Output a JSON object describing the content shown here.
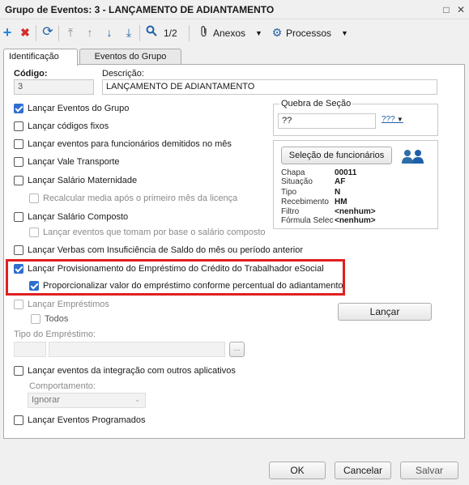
{
  "window": {
    "title": "Grupo de Eventos: 3 - LANÇAMENTO DE ADIANTAMENTO"
  },
  "toolbar": {
    "page_indicator": "1/2",
    "anexos_label": "Anexos",
    "processos_label": "Processos"
  },
  "tabs": [
    {
      "label": "Identificação",
      "active": true
    },
    {
      "label": "Eventos do Grupo",
      "active": false
    }
  ],
  "form": {
    "codigo_label": "Código:",
    "codigo_value": "3",
    "descricao_label": "Descrição:",
    "descricao_value": "LANÇAMENTO DE ADIANTAMENTO",
    "quebra_label": "Quebra de Seção",
    "quebra_value": "??",
    "quebra_selector": "???"
  },
  "checkboxes": [
    {
      "label": "Lançar Eventos do Grupo",
      "checked": true,
      "enabled": true
    },
    {
      "label": "Lançar códigos fixos",
      "checked": false,
      "enabled": true
    },
    {
      "label": "Lançar eventos para funcionários demitidos no mês",
      "checked": false,
      "enabled": true
    },
    {
      "label": "Lançar Vale Transporte",
      "checked": false,
      "enabled": true
    },
    {
      "label": "Lançar Salário Maternidade",
      "checked": false,
      "enabled": true
    },
    {
      "label": "Recalcular media após o primeiro mês da licença",
      "checked": false,
      "enabled": false
    },
    {
      "label": "Lançar Salário Composto",
      "checked": false,
      "enabled": true
    },
    {
      "label": "Lançar eventos que tomam por base o salário composto",
      "checked": false,
      "enabled": false
    },
    {
      "label": "Lançar Verbas com Insuficiência de Saldo do mês ou período anterior",
      "checked": false,
      "enabled": true
    },
    {
      "label": "Lançar Provisionamento do Empréstimo do Crédito do Trabalhador eSocial",
      "checked": true,
      "enabled": true
    },
    {
      "label": "Proporcionalizar valor do empréstimo conforme percentual do adiantamento",
      "checked": true,
      "enabled": true
    },
    {
      "label": "Lançar Empréstimos",
      "checked": false,
      "enabled": false
    },
    {
      "label": "Todos",
      "checked": false,
      "enabled": false
    },
    {
      "label": "Lançar eventos da integração com outros aplicativos",
      "checked": false,
      "enabled": true
    },
    {
      "label": "Lançar Eventos Programados",
      "checked": false,
      "enabled": true
    }
  ],
  "emprestimo": {
    "tipo_label": "Tipo do Empréstimo:",
    "browse_label": "..."
  },
  "comportamento": {
    "label": "Comportamento:",
    "value": "Ignorar"
  },
  "selecao": {
    "button_label": "Seleção de funcionários",
    "rows": [
      {
        "key": "Chapa",
        "value": "00011"
      },
      {
        "key": "Situação",
        "value": "AF"
      },
      {
        "key": "Tipo",
        "value": "N"
      },
      {
        "key": "Recebimento",
        "value": "HM"
      },
      {
        "key": "Filtro",
        "value": "<nenhum>"
      },
      {
        "key": "Fórmula Selec",
        "value": "<nenhum>"
      }
    ]
  },
  "lancar_button": "Lançar",
  "footer": {
    "ok": "OK",
    "cancelar": "Cancelar",
    "salvar": "Salvar"
  },
  "colors": {
    "accent": "#2f6fd0",
    "highlight": "#e02020",
    "add_icon": "#1e88e5",
    "delete_icon": "#d32f2f"
  }
}
